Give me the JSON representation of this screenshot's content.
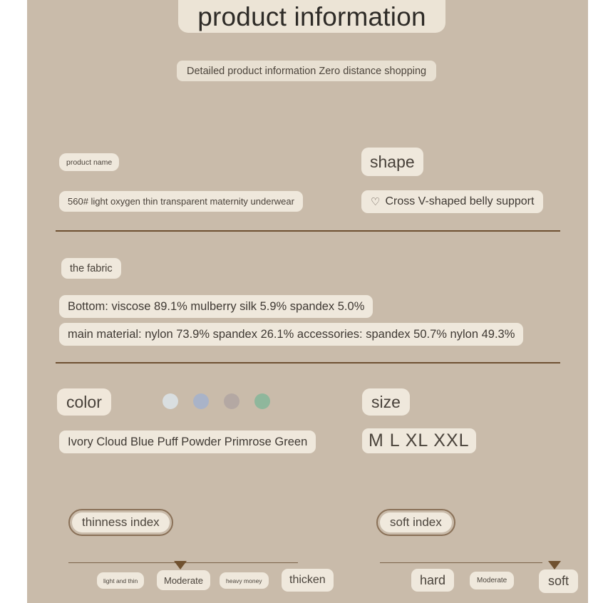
{
  "header": {
    "title": "product information",
    "subtitle": "Detailed product information Zero distance shopping"
  },
  "sections": {
    "product_name": {
      "label": "product name",
      "value": "560# light oxygen thin transparent maternity underwear"
    },
    "shape": {
      "label": "shape",
      "icon": "heart-icon",
      "value": "Cross V-shaped belly support"
    },
    "fabric": {
      "label": "the fabric",
      "line1": "Bottom: viscose 89.1% mulberry silk 5.9% spandex 5.0%",
      "line2": "main material: nylon 73.9% spandex 26.1% accessories: spandex 50.7% nylon 49.3%"
    },
    "color": {
      "label": "color",
      "value": "Ivory Cloud Blue Puff Powder Primrose Green",
      "swatches": [
        {
          "name": "Ivory",
          "hex": "#d9dee0"
        },
        {
          "name": "Cloud Blue",
          "hex": "#a9b3c8"
        },
        {
          "name": "Puff Powder",
          "hex": "#b4a8a3"
        },
        {
          "name": "Primrose Green",
          "hex": "#8fb79c"
        }
      ]
    },
    "size": {
      "label": "size",
      "value": "M L XL XXL"
    },
    "thinness_index": {
      "label": "thinness index",
      "scale": [
        "light and thin",
        "Moderate",
        "heavy money",
        "thicken"
      ],
      "selected": "Moderate"
    },
    "soft_index": {
      "label": "soft index",
      "scale": [
        "hard",
        "Moderate",
        "soft"
      ],
      "selected": "soft"
    }
  },
  "theme": {
    "background": "#c9bbaa",
    "pill": "#efe8dc",
    "divider": "#6e5032",
    "marker": "#70512f"
  }
}
